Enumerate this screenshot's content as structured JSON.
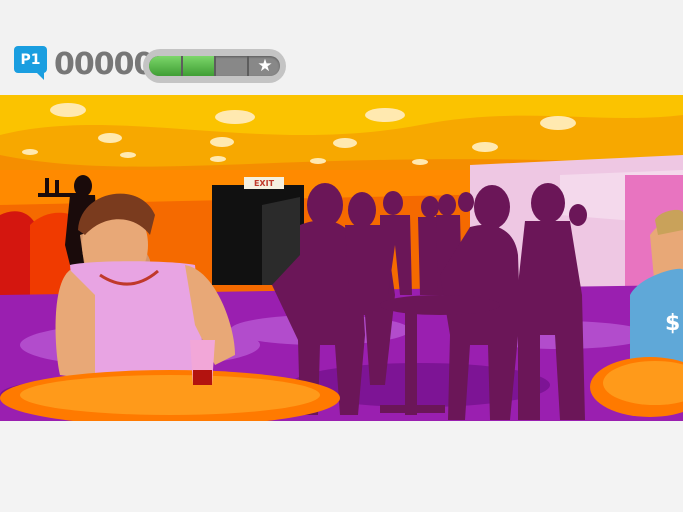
{
  "hud": {
    "player_label": "P1",
    "score": "00000",
    "meter": {
      "level_fraction": 0.5,
      "segments": 4,
      "end_icon": "star-icon"
    }
  },
  "scene": {
    "exit_sign": "EXIT",
    "colors": {
      "ceiling": "#f7a800",
      "back_wall": "#f56a00",
      "floor": "#9a1fb0",
      "silhouette": "#6b1658",
      "right_wall": "#eec7e3"
    }
  }
}
